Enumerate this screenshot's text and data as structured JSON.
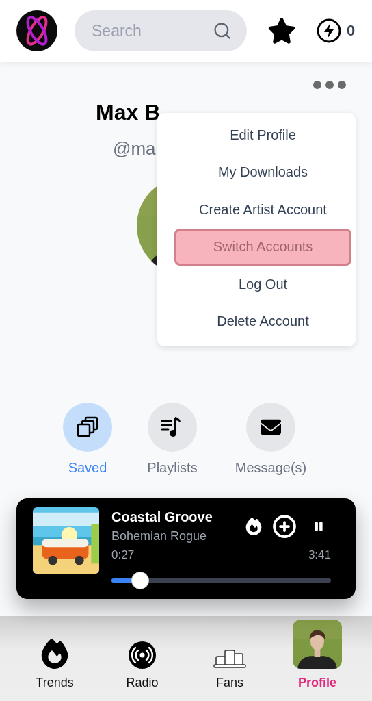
{
  "header": {
    "search": {
      "placeholder": "Search"
    },
    "points": "0"
  },
  "profile": {
    "name": "Max B",
    "handle": "@ma"
  },
  "menu": {
    "items": [
      {
        "label": "Edit Profile",
        "selected": false
      },
      {
        "label": "My Downloads",
        "selected": false
      },
      {
        "label": "Create Artist Account",
        "selected": false
      },
      {
        "label": "Switch Accounts",
        "selected": true
      },
      {
        "label": "Log Out",
        "selected": false
      },
      {
        "label": "Delete Account",
        "selected": false
      }
    ]
  },
  "actions": [
    {
      "label": "Saved",
      "kind": "saved",
      "selected": true
    },
    {
      "label": "Playlists",
      "kind": "playlists",
      "selected": false
    },
    {
      "label": "Message(s)",
      "kind": "message",
      "selected": false
    }
  ],
  "player": {
    "title": "Coastal Groove",
    "artist": "Bohemian Rogue",
    "elapsed": "0:27",
    "duration": "3:41",
    "level": 0.13,
    "playing": true
  },
  "nav": [
    {
      "label": "Trends",
      "kind": "trends",
      "selected": false
    },
    {
      "label": "Radio",
      "kind": "radio",
      "selected": false
    },
    {
      "label": "Fans",
      "kind": "fans",
      "selected": false
    },
    {
      "label": "Profile",
      "kind": "profile",
      "selected": true
    }
  ]
}
